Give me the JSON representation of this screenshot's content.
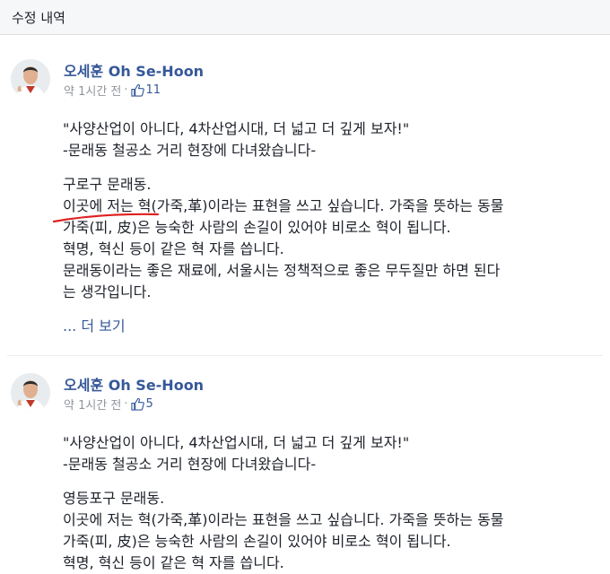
{
  "header": {
    "title": "수정 내역"
  },
  "posts": [
    {
      "author": "오세훈 Oh Se-Hoon",
      "time": "약 1시간 전",
      "separator": "·",
      "likes": "11",
      "lines": [
        "\"사양산업이 아니다, 4차산업시대, 더 넓고 더 깊게 보자!\"",
        "-문래동 철공소 거리 현장에 다녀왔습니다-",
        "구로구 문래동.",
        "이곳에 저는 혁(가죽,革)이라는 표현을 쓰고 싶습니다. 가죽을 뜻하는 동물",
        "가죽(피, 皮)은 능숙한 사람의 손길이 있어야 비로소 혁이 됩니다.",
        "혁명, 혁신 등이 같은 혁 자를 씁니다.",
        "문래동이라는 좋은 재료에, 서울시는 정책적으로 좋은 무두질만 하면 된다",
        "는 생각입니다."
      ],
      "more": "... 더 보기"
    },
    {
      "author": "오세훈 Oh Se-Hoon",
      "time": "약 1시간 전",
      "separator": "·",
      "likes": "5",
      "lines": [
        "\"사양산업이 아니다, 4차산업시대, 더 넓고 더 깊게 보자!\"",
        "-문래동 철공소 거리 현장에 다녀왔습니다-",
        "영등포구 문래동.",
        "이곳에 저는 혁(가죽,革)이라는 표현을 쓰고 싶습니다. 가죽을 뜻하는 동물",
        "가죽(피, 皮)은 능숙한 사람의 손길이 있어야 비로소 혁이 됩니다.",
        "혁명, 혁신 등이 같은 혁 자를 씁니다."
      ]
    }
  ],
  "colors": {
    "link": "#365899",
    "meta": "#90949c",
    "annotation": "#e02020"
  },
  "icons": {
    "avatar": "profile-photo",
    "like": "thumbs-up-icon"
  }
}
